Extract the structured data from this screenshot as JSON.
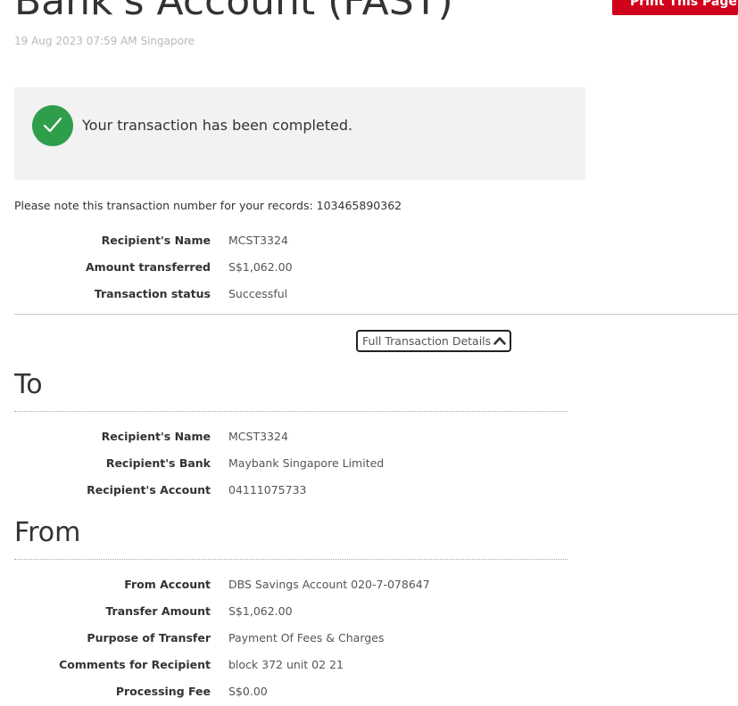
{
  "header": {
    "title": "Bank's Account (FAST)",
    "timestamp": "19 Aug 2023 07:59 AM Singapore",
    "print_label": "Print This Page"
  },
  "status": {
    "message": "Your transaction has been completed.",
    "icon": "check-circle-icon",
    "icon_color": "#2e9e4b"
  },
  "transaction_note": "Please note this transaction number for your records: 103465890362",
  "summary": [
    {
      "label": "Recipient's Name",
      "value": "MCST3324"
    },
    {
      "label": "Amount transferred",
      "value": "S$1,062.00"
    },
    {
      "label": "Transaction status",
      "value": "Successful"
    }
  ],
  "details_toggle": {
    "label": "Full Transaction Details",
    "icon": "chevron-up-icon"
  },
  "to_section": {
    "heading": "To",
    "rows": [
      {
        "label": "Recipient's Name",
        "value": "MCST3324"
      },
      {
        "label": "Recipient's Bank",
        "value": "Maybank Singapore Limited"
      },
      {
        "label": "Recipient's Account",
        "value": "04111075733"
      }
    ]
  },
  "from_section": {
    "heading": "From",
    "rows": [
      {
        "label": "From Account",
        "value": "DBS Savings Account 020-7-078647"
      },
      {
        "label": "Transfer Amount",
        "value": "S$1,062.00"
      },
      {
        "label": "Purpose of Transfer",
        "value": "Payment Of Fees & Charges"
      },
      {
        "label": "Comments for Recipient",
        "value": "block 372 unit 02 21"
      },
      {
        "label": "Processing Fee",
        "value": "S$0.00"
      }
    ]
  },
  "colors": {
    "brand_red": "#d0021b",
    "success_green": "#2e9e4b",
    "panel_gray": "#f2f2f2"
  }
}
